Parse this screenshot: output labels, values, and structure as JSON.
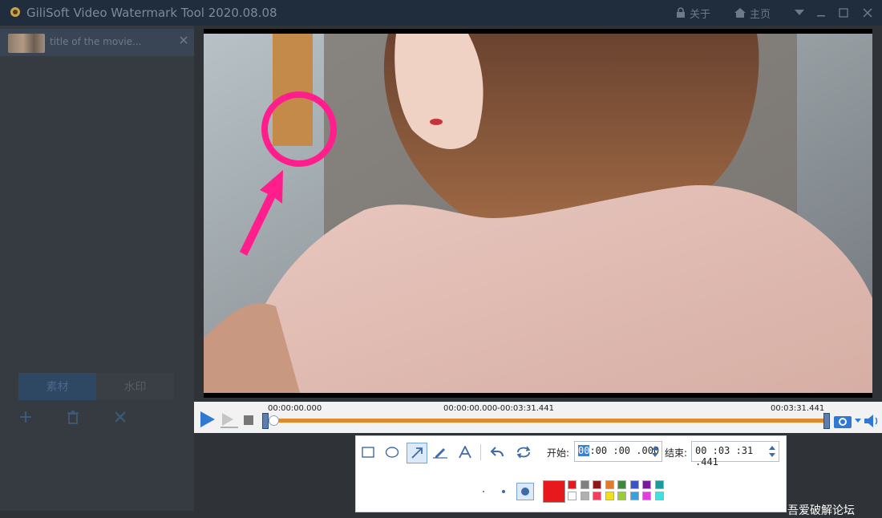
{
  "app": {
    "title": "GiliSoft Video Watermark Tool 2020.08.08",
    "about_label": "关于",
    "home_label": "主页"
  },
  "left_panel": {
    "file_name": "title of the movie...",
    "tabs": [
      {
        "label": "素材",
        "active": true
      },
      {
        "label": "水印",
        "active": false
      }
    ]
  },
  "player": {
    "start_time": "00:00:00.000",
    "range": "00:00:00.000-00:03:31.441",
    "end_time": "00:03:31.441"
  },
  "draw_toolbar": {
    "start_label": "开始:",
    "end_label": "结束:",
    "start_value_hl": "00",
    "start_value_rest": ":00 :00 .000",
    "end_value": "00 :03 :31 .441",
    "selected_color": "#e8191d",
    "palette": [
      [
        "#e8191d",
        "#808080",
        "#8b1a1a",
        "#e07a2c",
        "#3a8a3a",
        "#3a55c8",
        "#7a1a9a",
        "#1a9a9a"
      ],
      [
        "#ffffff",
        "#b0b0b0",
        "#f04060",
        "#f0e020",
        "#9acd32",
        "#3aa0e0",
        "#e040e0",
        "#40e0e0"
      ]
    ]
  },
  "watermark_text": "吾爱破解论坛"
}
